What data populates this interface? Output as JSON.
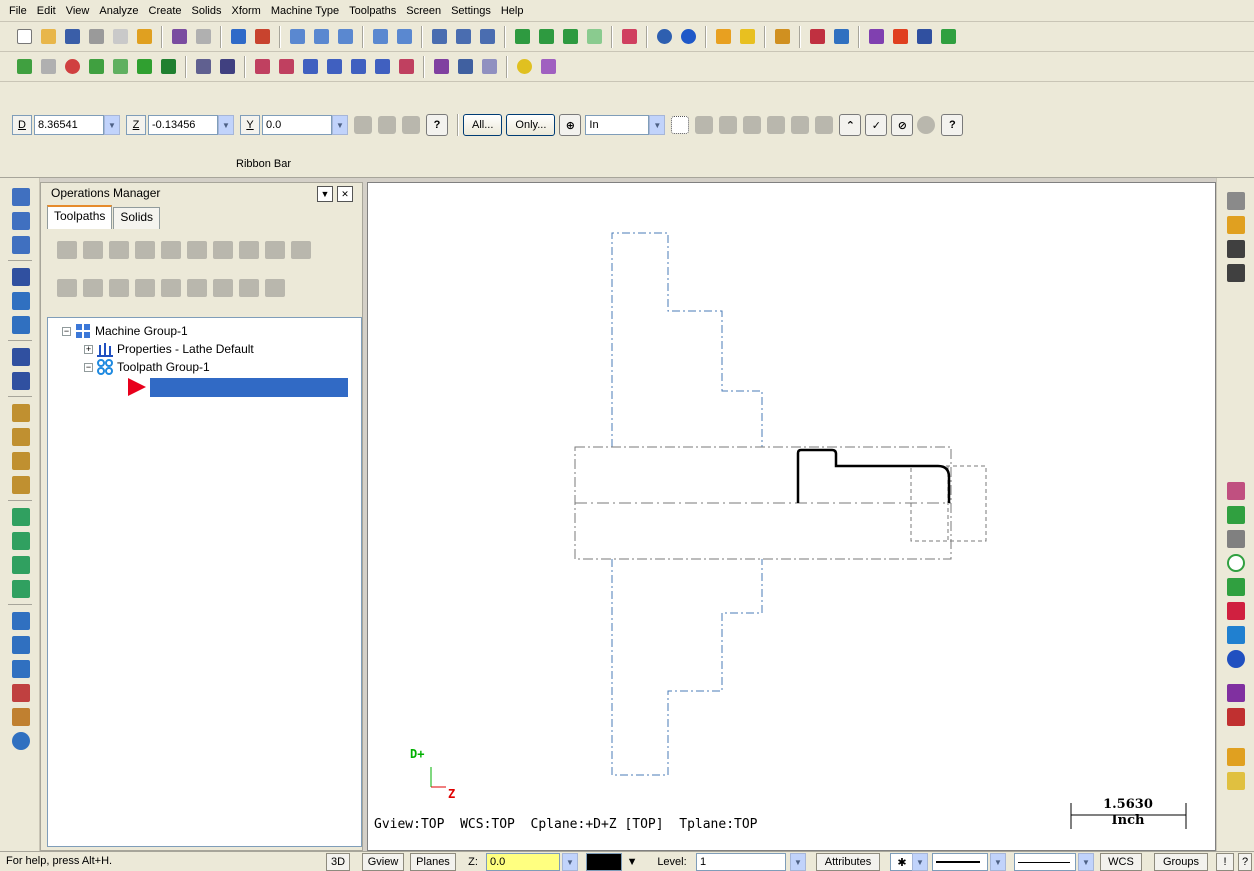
{
  "menu": [
    "File",
    "Edit",
    "View",
    "Analyze",
    "Create",
    "Solids",
    "Xform",
    "Machine Type",
    "Toolpaths",
    "Screen",
    "Settings",
    "Help"
  ],
  "ribbon": {
    "d_label": "D",
    "d_value": "8.36541",
    "z_label": "Z",
    "z_value": "-0.13456",
    "y_label": "Y",
    "y_value": "0.0",
    "all_button": "All...",
    "only_button": "Only...",
    "units_value": "In",
    "title": "Ribbon Bar"
  },
  "ops_manager": {
    "title": "Operations Manager",
    "tabs": [
      "Toolpaths",
      "Solids"
    ],
    "active_tab": "Toolpaths",
    "tree": {
      "machine_group": "Machine Group-1",
      "properties": "Properties - Lathe Default",
      "toolpath_group": "Toolpath Group-1"
    }
  },
  "viewport": {
    "status_line": "Gview:TOP  WCS:TOP  Cplane:+D+Z [TOP]  Tplane:TOP",
    "axis_up_label": "D+",
    "axis_right_label": "Z",
    "scale_value": "1.5630",
    "scale_unit": "Inch"
  },
  "statusbar": {
    "help_text": "For help, press Alt+H.",
    "btn_3d": "3D",
    "btn_gview": "Gview",
    "btn_planes": "Planes",
    "z_label": "Z:",
    "z_value": "0.0",
    "level_label": "Level:",
    "level_value": "1",
    "attributes": "Attributes",
    "wcs": "WCS",
    "groups": "Groups",
    "bang": "!",
    "question": "?"
  },
  "colors": {
    "chrome": "#ece9d8",
    "selection": "#316ac5",
    "chuck_blue": "#4a7bb7",
    "stock_gray": "#7a7a7a",
    "part_black": "#000000",
    "axis_green": "#00b000",
    "axis_red": "#e00000",
    "z_field_yellow": "#ffff80"
  }
}
